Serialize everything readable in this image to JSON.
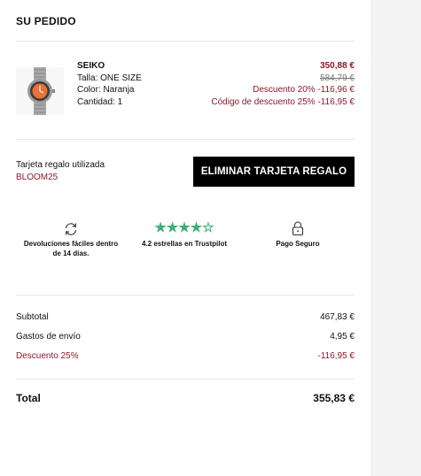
{
  "order": {
    "title": "SU PEDIDO"
  },
  "product": {
    "brand": "SEIKO",
    "size": "Talla: ONE SIZE",
    "color": "Color: Naranja",
    "quantity": "Cantidad: 1",
    "price": "350,88 €",
    "original_price": "584,79 €",
    "discount_1": "Descuento 20% -116,96 €",
    "discount_2": "Código de descuento 25% -116,95 €",
    "dial_color": "#e8733a"
  },
  "gift_card": {
    "label": "Tarjeta regalo utilizada",
    "code": "BLOOM25",
    "button_label": "ELIMINAR TARJETA REGALO"
  },
  "badges": [
    {
      "icon": "refresh-icon",
      "label": "Devoluciones fáciles dentro de 14 días."
    },
    {
      "icon": "star-rating-icon",
      "stars": "★★★★☆",
      "label": "4.2 estrellas en Trustpilot",
      "rating": 4.2
    },
    {
      "icon": "lock-icon",
      "label": "Pago Seguro"
    }
  ],
  "summary": {
    "subtotal_label": "Subtotal",
    "subtotal_value": "467,83 €",
    "shipping_label": "Gastos de envío",
    "shipping_value": "4,95 €",
    "discount_label": "Descuento 25%",
    "discount_value": "-116,95 €",
    "total_label": "Total",
    "total_value": "355,83 €"
  },
  "colors": {
    "accent_red": "#8b1a2b",
    "star_green": "#3cb07a",
    "button_black": "#000000"
  }
}
